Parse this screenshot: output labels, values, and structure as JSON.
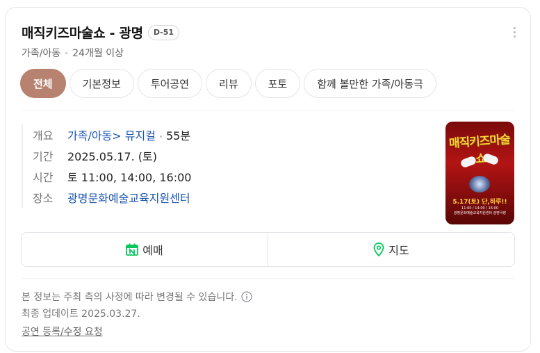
{
  "header": {
    "title": "매직키즈마술쇼 - 광명",
    "dday": "D-51",
    "genre": "가족/아동",
    "age": "24개월 이상"
  },
  "tabs": [
    {
      "label": "전체",
      "active": true
    },
    {
      "label": "기본정보"
    },
    {
      "label": "투어공연"
    },
    {
      "label": "리뷰"
    },
    {
      "label": "포토"
    },
    {
      "label": "함께 볼만한 가족/아동극"
    }
  ],
  "info": {
    "overview_label": "개요",
    "overview_genre": "가족/아동",
    "overview_subgenre": "뮤지컬",
    "overview_duration": "55분",
    "period_label": "기간",
    "period": "2025.05.17. (토)",
    "time_label": "시간",
    "time": "토 11:00, 14:00, 16:00",
    "venue_label": "장소",
    "venue": "광명문화예술교육지원센터"
  },
  "poster": {
    "title": "매직키즈마술쇼",
    "date": "5.17(토) 단,하루!!",
    "small_line1": "11:00 / 14:00 / 16:00",
    "small_line2": "광명문화예술교육지원센터 광명극장"
  },
  "actions": {
    "reserve": "예매",
    "map": "지도"
  },
  "footer": {
    "notice": "본 정보는 주최 측의 사정에 따라 변경될 수 있습니다.",
    "updated": "최종 업데이트 2025.03.27.",
    "report": "공연 등록/수정 요청"
  },
  "colors": {
    "active_tab": "#b7826f",
    "link": "#1c56b0",
    "naver_green": "#03c75a"
  }
}
